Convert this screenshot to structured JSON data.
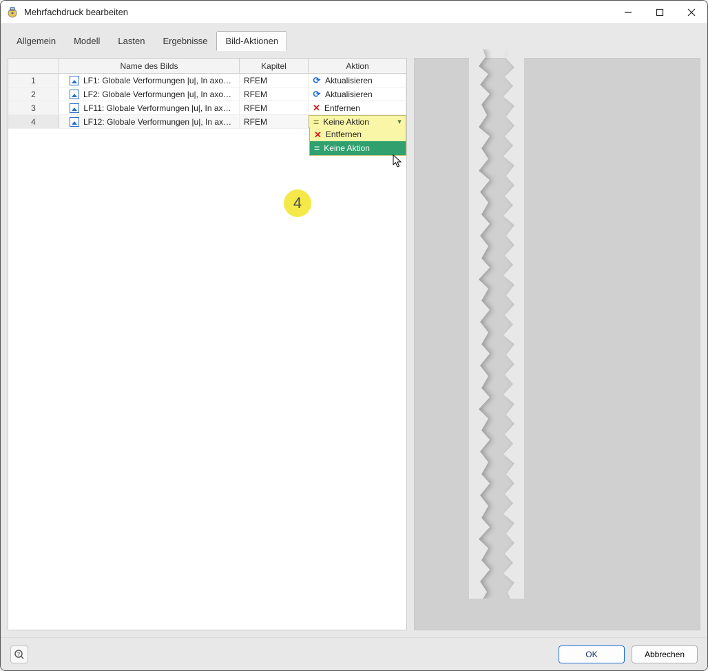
{
  "window": {
    "title": "Mehrfachdruck bearbeiten"
  },
  "tabs": [
    {
      "label": "Allgemein",
      "active": false
    },
    {
      "label": "Modell",
      "active": false
    },
    {
      "label": "Lasten",
      "active": false
    },
    {
      "label": "Ergebnisse",
      "active": false
    },
    {
      "label": "Bild-Aktionen",
      "active": true
    }
  ],
  "grid": {
    "headers": {
      "name": "Name des Bilds",
      "kapitel": "Kapitel",
      "aktion": "Aktion"
    },
    "rows": [
      {
        "num": "1",
        "name": "LF1: Globale Verformungen |u|, In axo…",
        "kapitel": "RFEM",
        "action_icon": "refresh",
        "action_label": "Aktualisieren"
      },
      {
        "num": "2",
        "name": "LF2: Globale Verformungen |u|, In axo…",
        "kapitel": "RFEM",
        "action_icon": "refresh",
        "action_label": "Aktualisieren"
      },
      {
        "num": "3",
        "name": "LF11: Globale Verformungen |u|, In ax…",
        "kapitel": "RFEM",
        "action_icon": "remove",
        "action_label": "Entfernen"
      },
      {
        "num": "4",
        "name": "LF12: Globale Verformungen |u|, In ax…",
        "kapitel": "RFEM",
        "action_icon": "none",
        "action_label": "Keine Aktion"
      }
    ]
  },
  "dropdown": {
    "selected": "Keine Aktion",
    "options": [
      {
        "icon": "remove",
        "label": "Entfernen"
      },
      {
        "icon": "none",
        "label": "Keine Aktion"
      }
    ]
  },
  "marker": {
    "label": "4"
  },
  "footer": {
    "ok": "OK",
    "cancel": "Abbrechen"
  }
}
